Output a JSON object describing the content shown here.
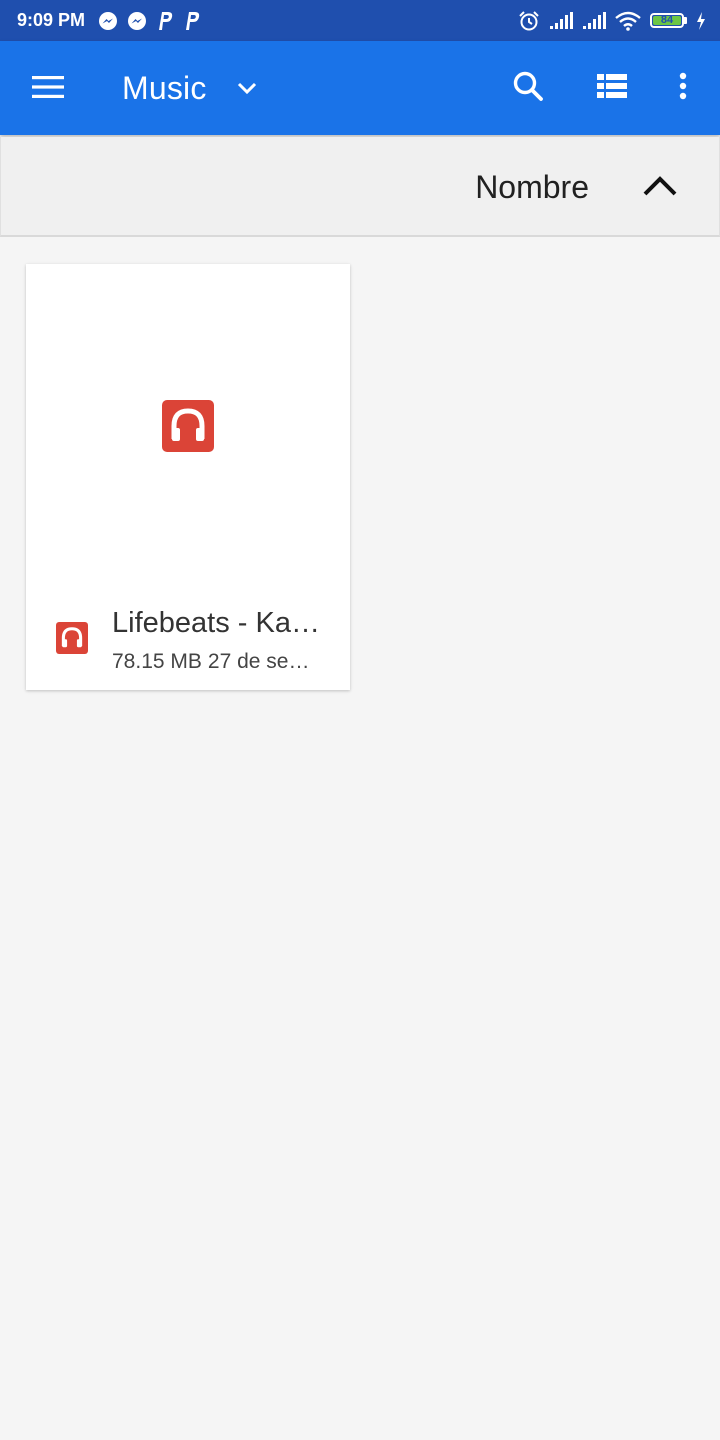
{
  "status_bar": {
    "time": "9:09 PM",
    "notification_icons": [
      "messenger-icon",
      "messenger-icon",
      "parking-p-icon",
      "parking-p-icon"
    ],
    "system_icons": [
      "alarm-icon",
      "signal-icon",
      "signal-icon",
      "wifi-icon",
      "battery-icon",
      "charging-icon"
    ],
    "battery_level": "84",
    "battery_color": "#6cc644"
  },
  "app_bar": {
    "title": "Music",
    "background": "#1a73e8",
    "icons": [
      "menu-icon",
      "chevron-down-icon",
      "search-icon",
      "list-view-icon",
      "more-vert-icon"
    ]
  },
  "sort_bar": {
    "label": "Nombre",
    "direction_icon": "chevron-up-icon"
  },
  "files": [
    {
      "name": "Lifebeats - Ka…",
      "size": "78.15 MB",
      "date": "27 de se…",
      "icon": "headphones-icon",
      "icon_color": "#db4437"
    }
  ]
}
